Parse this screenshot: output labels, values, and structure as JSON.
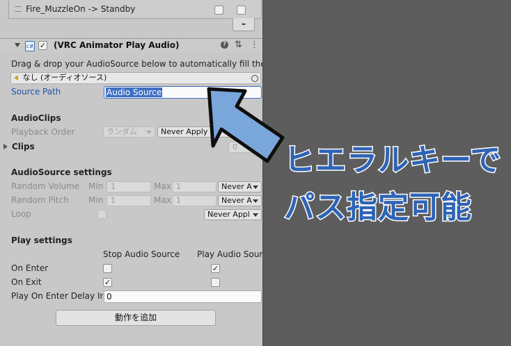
{
  "transition": {
    "label": "Fire_MuzzleOn -> Standby",
    "minus_label": "–"
  },
  "component": {
    "title": "(VRC Animator Play Audio)",
    "enabled_mark": "✓",
    "help_icon": "help-icon",
    "settings_icon": "sliders-icon",
    "menu_icon": "kebab-menu-icon"
  },
  "description": "Drag & drop your AudioSource below to automatically fill the",
  "audio_field": {
    "value": "なし (オーディオソース)"
  },
  "source_path": {
    "label": "Source Path",
    "value": "Audio Source"
  },
  "audioclips": {
    "header": "AudioClips",
    "playback_order_label": "Playback Order",
    "playback_order_value": "ランダム",
    "playback_apply": "Never Apply",
    "clips_label": "Clips",
    "clips_count": "0"
  },
  "audiosource": {
    "header": "AudioSource settings",
    "random_volume_label": "Random Volume",
    "random_pitch_label": "Random Pitch",
    "loop_label": "Loop",
    "min_label": "Min",
    "max_label": "Max",
    "volume_min": "1",
    "volume_max": "1",
    "pitch_min": "1",
    "pitch_max": "1",
    "volume_apply": "Never A",
    "pitch_apply": "Never A",
    "loop_apply": "Never Appl"
  },
  "play": {
    "header": "Play settings",
    "col_stop": "Stop Audio Source",
    "col_play": "Play Audio Sourc",
    "on_enter_label": "On Enter",
    "on_exit_label": "On Exit",
    "delay_label": "Play On Enter Delay In",
    "delay_value": "0",
    "on_enter_play_check": "✓",
    "on_exit_stop_check": "✓"
  },
  "add_button": {
    "label": "動作を追加"
  },
  "overlay": {
    "line1": "ヒエラルキーで",
    "line2": "パス指定可能",
    "arrow_color": "#7aa7db",
    "text_color": "#2f63b5"
  },
  "colors": {
    "inspector_bg": "#c8c8c8",
    "scene_bg": "#5d5d5d",
    "link_blue": "#2155a8",
    "selection_blue": "#3e6fc2"
  }
}
